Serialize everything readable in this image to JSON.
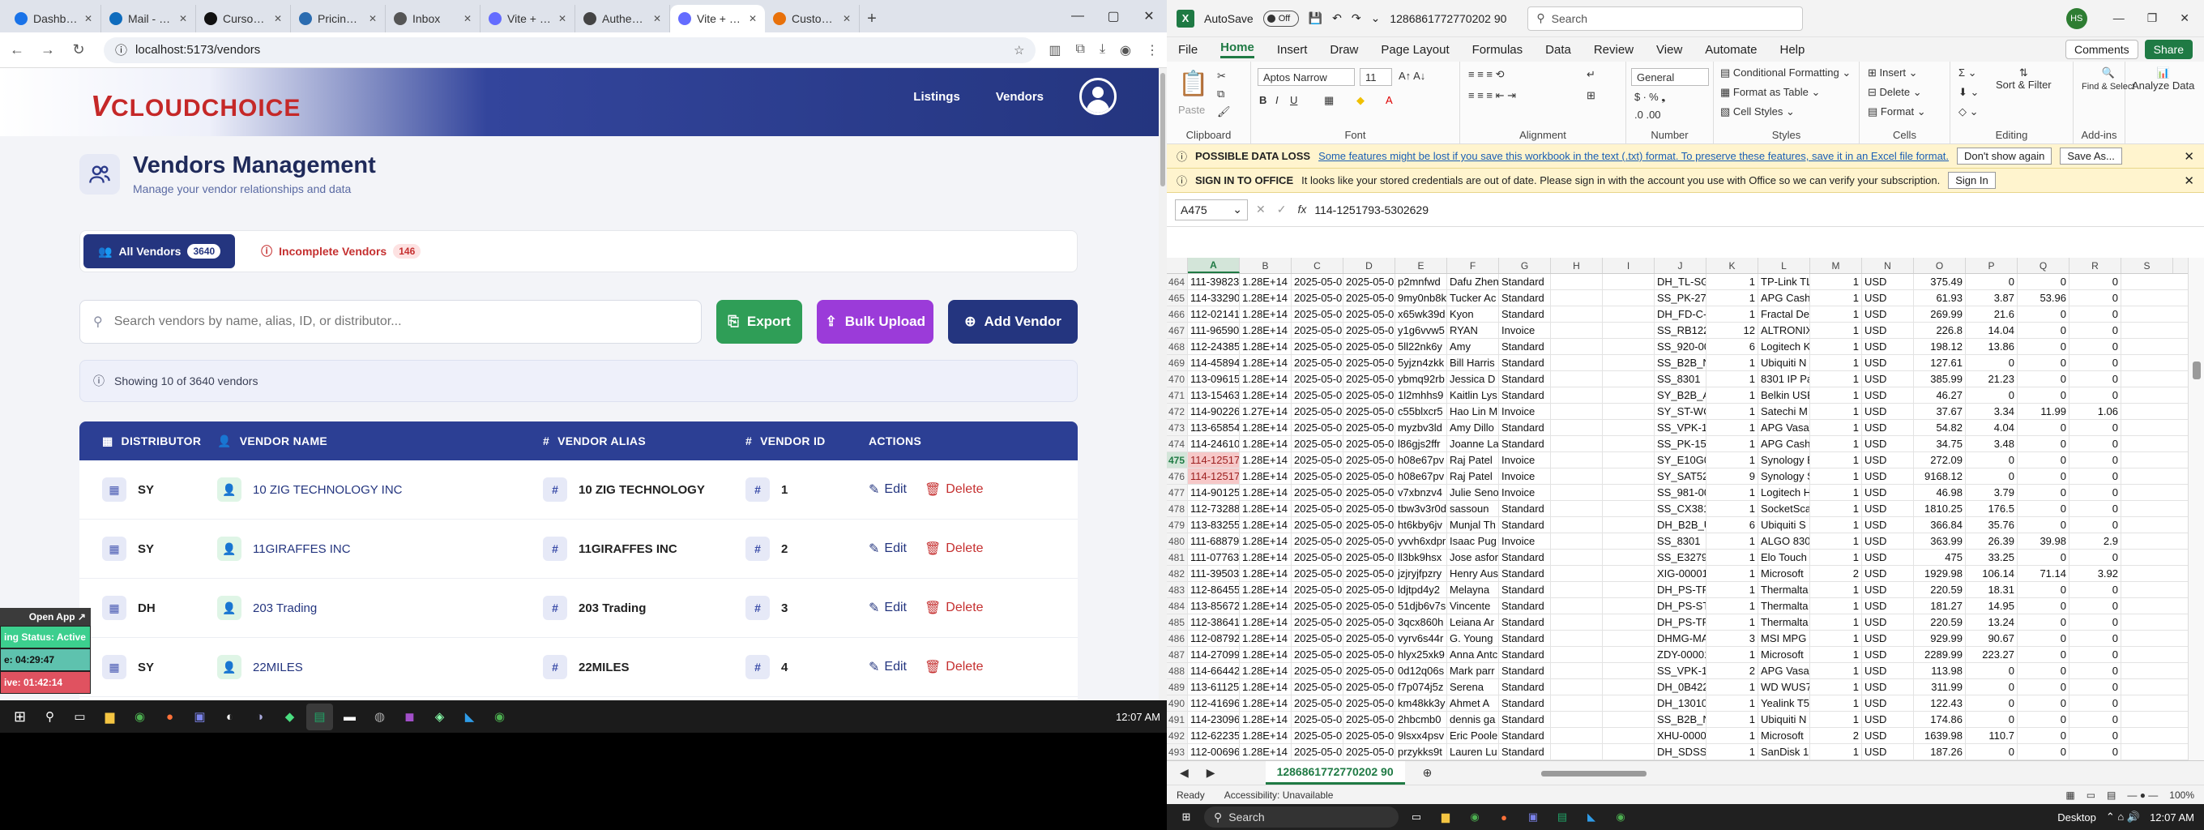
{
  "browser": {
    "tabs": [
      {
        "label": "Dashboard",
        "color": "#1a73e8",
        "icon": "globe-icon"
      },
      {
        "label": "Mail - Hass",
        "color": "#0f6cbd",
        "icon": "mail-icon"
      },
      {
        "label": "Cursor - Th",
        "color": "#111111",
        "icon": "cursor-icon"
      },
      {
        "label": "Pricing CM",
        "color": "#2b6cb0",
        "icon": "globe-icon"
      },
      {
        "label": "Inbox",
        "color": "#555555",
        "icon": "inbox-icon"
      },
      {
        "label": "Vite + Rea",
        "color": "#646cff",
        "icon": "vite-icon"
      },
      {
        "label": "Authentica",
        "color": "#444444",
        "icon": "github-icon"
      },
      {
        "label": "Vite + Rea",
        "color": "#646cff",
        "icon": "vite-icon"
      },
      {
        "label": "Customer M",
        "color": "#e8710a",
        "icon": "globe-icon"
      }
    ],
    "active_tab": 7,
    "url": "localhost:5173/vendors"
  },
  "app": {
    "logo_v": "V",
    "logo_text": "CLOUDCHOICE",
    "nav": [
      "Listings",
      "Vendors"
    ],
    "page_title": "Vendors Management",
    "page_subtitle": "Manage your vendor relationships and data",
    "tabs": [
      {
        "label": "All Vendors",
        "count": "3640"
      },
      {
        "label": "Incomplete Vendors",
        "count": "146"
      }
    ],
    "search_placeholder": "Search vendors by name, alias, ID, or distributor...",
    "buttons": {
      "export": "Export",
      "bulk": "Bulk Upload",
      "add": "Add Vendor"
    },
    "info": "Showing 10 of 3640 vendors",
    "table": {
      "headers": [
        "DISTRIBUTOR",
        "VENDOR NAME",
        "VENDOR ALIAS",
        "VENDOR ID",
        "ACTIONS"
      ],
      "edit_label": "Edit",
      "delete_label": "Delete",
      "rows": [
        {
          "dist": "SY",
          "name": "10 ZIG TECHNOLOGY INC",
          "alias": "10 ZIG TECHNOLOGY",
          "id": "1"
        },
        {
          "dist": "SY",
          "name": "11GIRAFFES INC",
          "alias": "11GIRAFFES INC",
          "id": "2"
        },
        {
          "dist": "DH",
          "name": "203 Trading",
          "alias": "203 Trading",
          "id": "3"
        },
        {
          "dist": "SY",
          "name": "22MILES",
          "alias": "22MILES",
          "id": "4"
        }
      ]
    }
  },
  "overlay": {
    "open_app": "Open App ↗",
    "status": "ing Status: Active",
    "timer1": "e: 04:29:47",
    "timer2": "ive: 01:42:14"
  },
  "taskbar_left": {
    "time": "12:07 AM"
  },
  "excel": {
    "autosave": "AutoSave",
    "toggle": "Off",
    "filename": "1286861772770202 90",
    "search": "Search",
    "profile": "HS",
    "menu": [
      "File",
      "Home",
      "Insert",
      "Draw",
      "Page Layout",
      "Formulas",
      "Data",
      "Review",
      "View",
      "Automate",
      "Help"
    ],
    "comments": "Comments",
    "share": "Share",
    "ribbon": {
      "clipboard": "Clipboard",
      "paste": "Paste",
      "font": "Font",
      "font_name": "Aptos Narrow",
      "font_size": "11",
      "alignment": "Alignment",
      "number": "Number",
      "number_format": "General",
      "styles": "Styles",
      "cond": "Conditional Formatting",
      "fmt_table": "Format as Table",
      "cell_styles": "Cell Styles",
      "cells": "Cells",
      "insert": "Insert",
      "delete": "Delete",
      "format": "Format",
      "editing": "Editing",
      "sort": "Sort & Filter",
      "find": "Find & Select",
      "addins": "Add-ins",
      "analyze": "Analyze Data"
    },
    "msg1": {
      "title": "POSSIBLE DATA LOSS",
      "text": "Some features might be lost if you save this workbook in the text (.txt) format. To preserve these features, save it in an Excel file format.",
      "b1": "Don't show again",
      "b2": "Save As..."
    },
    "msg2": {
      "title": "SIGN IN TO OFFICE",
      "text": "It looks like your stored credentials are out of date. Please sign in with the account you use with Office so we can verify your subscription.",
      "b1": "Sign In"
    },
    "namebox": "A475",
    "formula": "114-1251793-5302629",
    "columns": [
      "A",
      "B",
      "C",
      "D",
      "E",
      "F",
      "G",
      "H",
      "I",
      "J",
      "K",
      "L",
      "M",
      "N",
      "O",
      "P",
      "Q",
      "R",
      "S"
    ],
    "rows": [
      [
        "464",
        "111-39823",
        "1.28E+14",
        "2025-05-0",
        "2025-05-0",
        "p2mnfwd",
        "Dafu Zhen",
        "Standard",
        "",
        "",
        "DH_TL-SG",
        "1",
        "TP-Link TL",
        "1",
        "USD",
        "375.49",
        "0",
        "0",
        "0"
      ],
      [
        "465",
        "114-33290",
        "1.28E+14",
        "2025-05-0",
        "2025-05-0",
        "9my0nb8k",
        "Tucker Ac",
        "Standard",
        "",
        "",
        "SS_PK-27-",
        "1",
        "APG Cash",
        "1",
        "USD",
        "61.93",
        "3.87",
        "53.96",
        "0"
      ],
      [
        "466",
        "112-02141",
        "1.28E+14",
        "2025-05-0",
        "2025-05-0",
        "x65wk39d",
        "Kyon",
        "Standard",
        "",
        "",
        "DH_FD-C-",
        "1",
        "Fractal De",
        "1",
        "USD",
        "269.99",
        "21.6",
        "0",
        "0"
      ],
      [
        "467",
        "111-96590",
        "1.28E+14",
        "2025-05-0",
        "2025-05-0",
        "y1g6vvw5",
        "RYAN",
        "Invoice",
        "",
        "",
        "SS_RB1224",
        "12",
        "ALTRONIX",
        "1",
        "USD",
        "226.8",
        "14.04",
        "0",
        "0"
      ],
      [
        "468",
        "112-24385",
        "1.28E+14",
        "2025-05-0",
        "2025-05-0",
        "5ll22nk6y",
        "Amy",
        "Standard",
        "",
        "",
        "SS_920-00",
        "6",
        "Logitech K",
        "1",
        "USD",
        "198.12",
        "13.86",
        "0",
        "0"
      ],
      [
        "469",
        "114-45894",
        "1.28E+14",
        "2025-05-0",
        "2025-05-0",
        "5yjzn4zkk",
        "Bill Harris",
        "Standard",
        "",
        "",
        "SS_B2B_N",
        "1",
        "Ubiquiti N",
        "1",
        "USD",
        "127.61",
        "0",
        "0",
        "0"
      ],
      [
        "470",
        "113-09615",
        "1.28E+14",
        "2025-05-0",
        "2025-05-0",
        "ybmq92rb",
        "Jessica D",
        "Standard",
        "",
        "",
        "SS_8301",
        "1",
        "8301 IP Pa",
        "1",
        "USD",
        "385.99",
        "21.23",
        "0",
        "0"
      ],
      [
        "471",
        "113-15463",
        "1.28E+14",
        "2025-05-0",
        "2025-05-0",
        "1l2mhhs9",
        "Kaitlin Lys",
        "Standard",
        "",
        "",
        "SY_B2B_A",
        "1",
        "Belkin USB",
        "1",
        "USD",
        "46.27",
        "0",
        "0",
        "0"
      ],
      [
        "472",
        "114-90226",
        "1.27E+14",
        "2025-05-0",
        "2025-05-0",
        "c55blxcr5",
        "Hao Lin M",
        "Invoice",
        "",
        "",
        "SY_ST-WC",
        "1",
        "Satechi M",
        "1",
        "USD",
        "37.67",
        "3.34",
        "11.99",
        "1.06"
      ],
      [
        "473",
        "113-65854",
        "1.28E+14",
        "2025-05-0",
        "2025-05-0",
        "myzbv3ld",
        "Amy Dillo",
        "Standard",
        "",
        "",
        "SS_VPK-15",
        "1",
        "APG Vasar",
        "1",
        "USD",
        "54.82",
        "4.04",
        "0",
        "0"
      ],
      [
        "474",
        "114-24610",
        "1.28E+14",
        "2025-05-0",
        "2025-05-0",
        "l86gjs2ffr",
        "Joanne La",
        "Standard",
        "",
        "",
        "SS_PK-15J",
        "1",
        "APG Cash",
        "1",
        "USD",
        "34.75",
        "3.48",
        "0",
        "0"
      ],
      [
        "475",
        "114-12517",
        "1.28E+14",
        "2025-05-0",
        "2025-05-0",
        "h08e67pv",
        "Raj Patel",
        "Invoice",
        "",
        "",
        "SY_E10G0",
        "1",
        "Synology E",
        "1",
        "USD",
        "272.09",
        "0",
        "0",
        "0"
      ],
      [
        "476",
        "114-12517",
        "1.28E+14",
        "2025-05-0",
        "2025-05-0",
        "h08e67pv",
        "Raj Patel",
        "Invoice",
        "",
        "",
        "SY_SAT522",
        "9",
        "Synology S",
        "1",
        "USD",
        "9168.12",
        "0",
        "0",
        "0"
      ],
      [
        "477",
        "114-90125",
        "1.28E+14",
        "2025-05-0",
        "2025-05-0",
        "v7xbnzv4",
        "Julie Seno",
        "Invoice",
        "",
        "",
        "SS_981-00",
        "1",
        "Logitech H",
        "1",
        "USD",
        "46.98",
        "3.79",
        "0",
        "0"
      ],
      [
        "478",
        "112-73288",
        "1.28E+14",
        "2025-05-0",
        "2025-05-0",
        "tbw3v3r0d",
        "sassoun",
        "Standard",
        "",
        "",
        "SS_CX3811",
        "1",
        "SocketSca",
        "1",
        "USD",
        "1810.25",
        "176.5",
        "0",
        "0"
      ],
      [
        "479",
        "113-83255",
        "1.28E+14",
        "2025-05-0",
        "2025-05-0",
        "ht6kby6jv",
        "Munjal Th",
        "Standard",
        "",
        "",
        "DH_B2B_U",
        "6",
        "Ubiquiti S",
        "1",
        "USD",
        "366.84",
        "35.76",
        "0",
        "0"
      ],
      [
        "480",
        "111-68879",
        "1.28E+14",
        "2025-05-0",
        "2025-05-0",
        "yvvh6xdpr",
        "Isaac Pug",
        "Invoice",
        "",
        "",
        "SS_8301",
        "1",
        "ALGO 8301",
        "1",
        "USD",
        "363.99",
        "26.39",
        "39.98",
        "2.9"
      ],
      [
        "481",
        "111-07763",
        "1.28E+14",
        "2025-05-0",
        "2025-05-0",
        "ll3bk9hsx",
        "Jose asfor",
        "Standard",
        "",
        "",
        "SS_E32791",
        "1",
        "Elo Touch",
        "1",
        "USD",
        "475",
        "33.25",
        "0",
        "0"
      ],
      [
        "482",
        "111-39503",
        "1.28E+14",
        "2025-05-0",
        "2025-05-0",
        "jzjryjfpzry",
        "Henry Aus",
        "Standard",
        "",
        "",
        "XIG-00001",
        "1",
        "Microsoft",
        "2",
        "USD",
        "1929.98",
        "106.14",
        "71.14",
        "3.92"
      ],
      [
        "483",
        "112-86455",
        "1.28E+14",
        "2025-05-0",
        "2025-05-0",
        "ldjtpd4y2",
        "Melayna",
        "Standard",
        "",
        "",
        "DH_PS-TPI",
        "1",
        "Thermalta",
        "1",
        "USD",
        "220.59",
        "18.31",
        "0",
        "0"
      ],
      [
        "484",
        "113-85672",
        "1.28E+14",
        "2025-05-0",
        "2025-05-0",
        "51djb6v7s",
        "Vincente",
        "Standard",
        "",
        "",
        "DH_PS-STI",
        "1",
        "Thermalta",
        "1",
        "USD",
        "181.27",
        "14.95",
        "0",
        "0"
      ],
      [
        "485",
        "112-38641",
        "1.28E+14",
        "2025-05-0",
        "2025-05-0",
        "3qcx860h",
        "Leiana Ar",
        "Standard",
        "",
        "",
        "DH_PS-TPI",
        "1",
        "Thermalta",
        "1",
        "USD",
        "220.59",
        "13.24",
        "0",
        "0"
      ],
      [
        "486",
        "112-08792",
        "1.28E+14",
        "2025-05-0",
        "2025-05-0",
        "vyrv6s44r",
        "G. Young",
        "Standard",
        "",
        "",
        "DHMG-MAG",
        "3",
        "MSI MPG 3",
        "1",
        "USD",
        "929.99",
        "90.67",
        "0",
        "0"
      ],
      [
        "487",
        "114-27099",
        "1.28E+14",
        "2025-05-0",
        "2025-05-0",
        "hlyx25xk9",
        "Anna Antc",
        "Standard",
        "",
        "",
        "ZDY-00001",
        "1",
        "Microsoft",
        "1",
        "USD",
        "2289.99",
        "223.27",
        "0",
        "0"
      ],
      [
        "488",
        "114-66442",
        "1.28E+14",
        "2025-05-0",
        "2025-05-0",
        "0d12q06s",
        "Mark parr",
        "Standard",
        "",
        "",
        "SS_VPK-15",
        "2",
        "APG Vasar",
        "1",
        "USD",
        "113.98",
        "0",
        "0",
        "0"
      ],
      [
        "489",
        "113-61125",
        "1.28E+14",
        "2025-05-0",
        "2025-05-0",
        "f7p074j5z",
        "Serena",
        "Standard",
        "",
        "",
        "DH_0B422",
        "1",
        "WD WUS72",
        "1",
        "USD",
        "311.99",
        "0",
        "0",
        "0"
      ],
      [
        "490",
        "112-41696",
        "1.28E+14",
        "2025-05-0",
        "2025-05-0",
        "km48kk3y",
        "Ahmet A",
        "Standard",
        "",
        "",
        "DH_13010",
        "1",
        "Yealink T5",
        "1",
        "USD",
        "122.43",
        "0",
        "0",
        "0"
      ],
      [
        "491",
        "114-23096",
        "1.28E+14",
        "2025-05-0",
        "2025-05-0",
        "2hbcmb0",
        "dennis ga",
        "Standard",
        "",
        "",
        "SS_B2B_N",
        "1",
        "Ubiquiti N",
        "1",
        "USD",
        "174.86",
        "0",
        "0",
        "0"
      ],
      [
        "492",
        "112-62235",
        "1.28E+14",
        "2025-05-0",
        "2025-05-0",
        "9lsxx4psv",
        "Eric Poole",
        "Standard",
        "",
        "",
        "XHU-0000",
        "1",
        "Microsoft",
        "2",
        "USD",
        "1639.98",
        "110.7",
        "0",
        "0"
      ],
      [
        "493",
        "112-00696",
        "1.28E+14",
        "2025-05-0",
        "2025-05-0",
        "przykks9t",
        "Lauren Lu",
        "Standard",
        "",
        "",
        "DH_SDSSD",
        "1",
        "SanDisk 1",
        "1",
        "USD",
        "187.26",
        "0",
        "0",
        "0"
      ]
    ],
    "sheet_tab": "1286861772770202 90",
    "status": "Ready",
    "accessibility": "Accessibility: Unavailable",
    "zoom": "100%"
  },
  "taskbar_right": {
    "search": "Search",
    "desktop": "Desktop",
    "time": "12:07 AM"
  }
}
